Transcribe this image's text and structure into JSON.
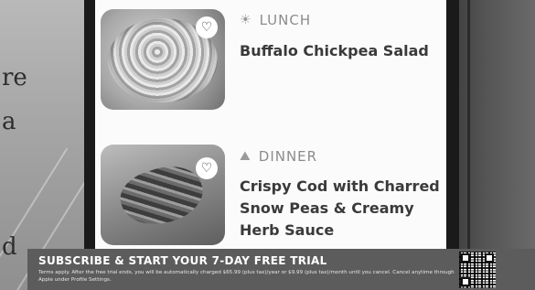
{
  "background": {
    "fragment_top": "re",
    "fragment_mid": "a",
    "fragment_bottom": "d"
  },
  "meals": [
    {
      "type": "LUNCH",
      "type_icon": "sun-icon",
      "name": "Buffalo Chickpea Salad",
      "favorite_icon": "heart-outline-icon"
    },
    {
      "type": "DINNER",
      "type_icon": "sunset-icon",
      "name": "Crispy Cod with Charred Snow Peas & Creamy Herb Sauce",
      "favorite_icon": "heart-outline-icon"
    }
  ],
  "banner": {
    "headline": "SUBSCRIBE & START YOUR 7-DAY FREE TRIAL",
    "fine_print": "Terms apply. After the free trial ends, you will be automatically charged $65.99 (plus tax)/year or $9.99 (plus tax)/month until you cancel. Cancel anytime through Apple under Profile Settings."
  },
  "colors": {
    "banner_bg": "#5c5c5c",
    "title_text": "#3a3a3a",
    "tag_text": "#8c8c8c"
  }
}
